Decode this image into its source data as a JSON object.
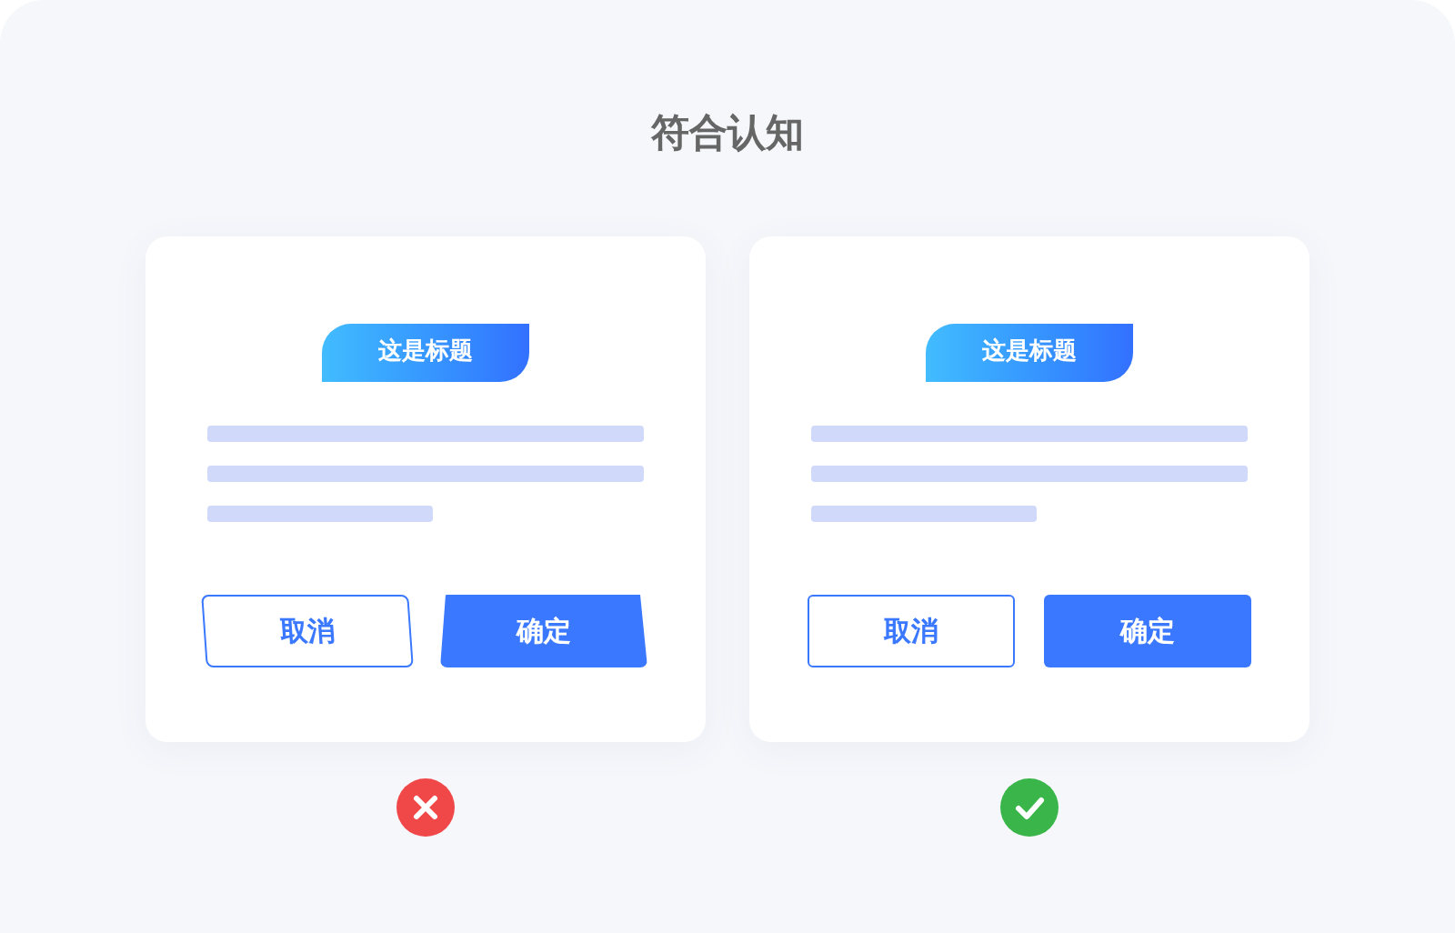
{
  "title": "符合认知",
  "examples": [
    {
      "kind": "skewed",
      "correct": false,
      "tag": "这是标题",
      "buttons": [
        {
          "label": "取消",
          "kind": "secondary"
        },
        {
          "label": "确定",
          "kind": "primary"
        }
      ]
    },
    {
      "kind": "straight",
      "correct": true,
      "tag": "这是标题",
      "buttons": [
        {
          "label": "取消",
          "kind": "secondary"
        },
        {
          "label": "确定",
          "kind": "primary"
        }
      ]
    }
  ]
}
